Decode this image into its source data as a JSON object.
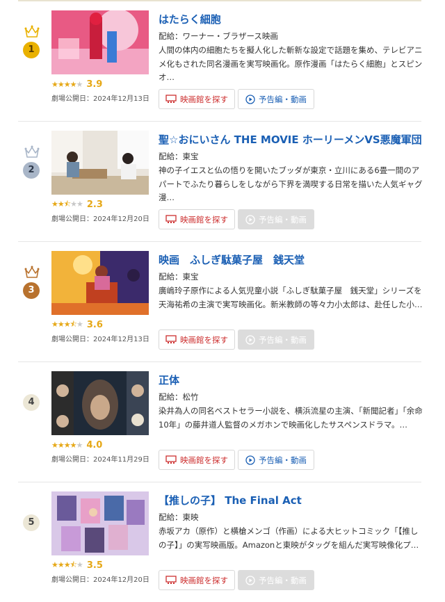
{
  "rankings": [
    {
      "rank": "1",
      "title": "はたらく細胞",
      "distributor": "配給：ワーナー・ブラザース映画",
      "description": "人間の体内の細胞たちを擬人化した斬新な設定で話題を集め、テレビアニメ化もされた同名漫画を実写映画化。原作漫画「はたらく細胞」とスピンオ…",
      "stars": "★★★★",
      "stars_off": "★",
      "score": "3.9",
      "release": "劇場公開日：2024年12月13日",
      "theater_button": "映画館を探す",
      "trailer_button": "予告編・動画",
      "trailer_enabled": true,
      "crown": "gold"
    },
    {
      "rank": "2",
      "title": "聖☆おにいさん THE MOVIE ホーリーメンVS悪魔軍団",
      "distributor": "配給：東宝",
      "description": "神の子イエスと仏の悟りを開いたブッダが東京・立川にある6畳一間のアパートでふたり暮らしをしながら下界を満喫する日常を描いた人気ギャグ漫…",
      "stars": "★★⯪",
      "stars_off": "★★",
      "score": "2.3",
      "release": "劇場公開日：2024年12月20日",
      "theater_button": "映画館を探す",
      "trailer_button": "予告編・動画",
      "trailer_enabled": false,
      "crown": "silver"
    },
    {
      "rank": "3",
      "title": "映画　ふしぎ駄菓子屋　銭天堂",
      "distributor": "配給：東宝",
      "description": "廣嶋玲子原作による人気児童小説「ふしぎ駄菓子屋　銭天堂」シリーズを天海祐希の主演で実写映画化。新米教師の等々力小太郎は、赴任した小…",
      "stars": "★★★⯪",
      "stars_off": "★",
      "score": "3.6",
      "release": "劇場公開日：2024年12月13日",
      "theater_button": "映画館を探す",
      "trailer_button": "予告編・動画",
      "trailer_enabled": false,
      "crown": "bronze"
    },
    {
      "rank": "4",
      "title": "正体",
      "distributor": "配給：松竹",
      "description": "染井為人の同名ベストセラー小説を、横浜流星の主演、「新聞記者」「余命10年」の藤井道人監督のメガホンで映画化したサスペンスドラマ。…",
      "stars": "★★★★",
      "stars_off": "★",
      "score": "4.0",
      "release": "劇場公開日：2024年11月29日",
      "theater_button": "映画館を探す",
      "trailer_button": "予告編・動画",
      "trailer_enabled": true,
      "crown": "none"
    },
    {
      "rank": "5",
      "title": "【推しの子】 The Final Act",
      "distributor": "配給：東映",
      "description": "赤坂アカ（原作）と横槍メンゴ（作画）による大ヒットコミック「【推しの子】」の実写映画版。Amazonと東映がタッグを組んだ実写映像化プ…",
      "stars": "★★★⯪",
      "stars_off": "★",
      "score": "3.5",
      "release": "劇場公開日：2024年12月20日",
      "theater_button": "映画館を探す",
      "trailer_button": "予告編・動画",
      "trailer_enabled": false,
      "crown": "none"
    }
  ],
  "colors": {
    "title": "#1a5fb4",
    "star": "#e6a817",
    "theater_red": "#cc2e2e",
    "gold": "#e9b100",
    "silver": "#a9b6c8",
    "bronze": "#b8722e",
    "plain_badge": "#ece7d6"
  }
}
